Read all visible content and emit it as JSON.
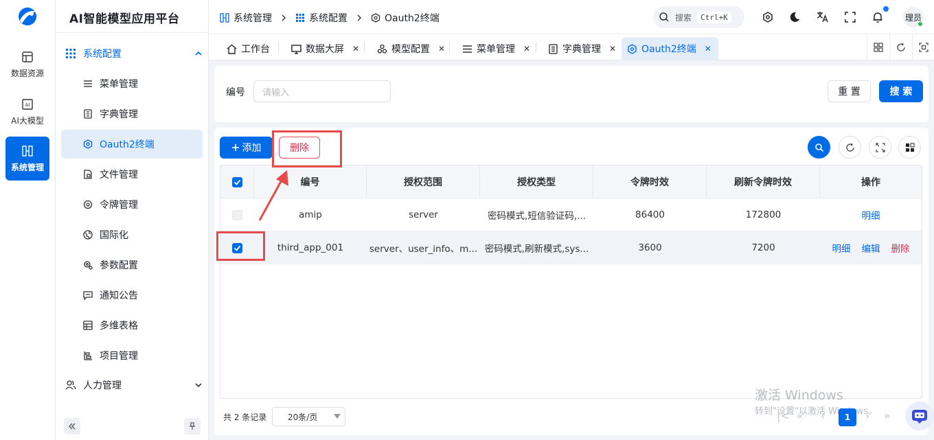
{
  "app": {
    "title": "AI智能模型应用平台"
  },
  "rail": {
    "items": [
      {
        "label": "数据资源"
      },
      {
        "label": "AI大模型"
      },
      {
        "label": "系统管理"
      }
    ]
  },
  "sidebar": {
    "group_system": "系统配置",
    "items": [
      {
        "label": "菜单管理"
      },
      {
        "label": "字典管理"
      },
      {
        "label": "Oauth2终端"
      },
      {
        "label": "文件管理"
      },
      {
        "label": "令牌管理"
      },
      {
        "label": "国际化"
      },
      {
        "label": "参数配置"
      },
      {
        "label": "通知公告"
      },
      {
        "label": "多维表格"
      },
      {
        "label": "项目管理"
      }
    ],
    "group_hr": "人力管理"
  },
  "header": {
    "breadcrumb": [
      "系统管理",
      "系统配置",
      "Oauth2终端"
    ],
    "search_label": "搜索",
    "search_shortcut": "Ctrl+K",
    "user": "理员"
  },
  "tabs": [
    {
      "label": "工作台"
    },
    {
      "label": "数据大屏"
    },
    {
      "label": "模型配置"
    },
    {
      "label": "菜单管理"
    },
    {
      "label": "字典管理"
    },
    {
      "label": "Oauth2终端"
    }
  ],
  "search_form": {
    "label": "编号",
    "placeholder": "请输入",
    "reset_label": "重 置",
    "search_label": "搜 索"
  },
  "toolbar": {
    "add_label": "添加",
    "delete_label": "删除"
  },
  "table": {
    "columns": [
      "编号",
      "授权范围",
      "授权类型",
      "令牌时效",
      "刷新令牌时效",
      "操作"
    ],
    "rows": [
      {
        "code": "amip",
        "scope": "server",
        "grant": "密码模式,短信验证码,...",
        "token": "86400",
        "refresh": "172800",
        "actions": [
          "明细"
        ]
      },
      {
        "code": "third_app_001",
        "scope": "server、user_info、m...",
        "grant": "密码模式,刷新模式,sys...",
        "token": "3600",
        "refresh": "7200",
        "actions": [
          "明细",
          "编辑",
          "删除"
        ]
      }
    ]
  },
  "footer": {
    "total": "共 2 条记录",
    "page_size": "20条/页",
    "current_page": "1"
  },
  "watermark": {
    "line1": "激活 Windows",
    "line2": "转到\"设置\"以激活 Windows。"
  },
  "colors": {
    "primary": "#006be6",
    "danger": "#e0294f",
    "annotation": "#e54b4b"
  }
}
